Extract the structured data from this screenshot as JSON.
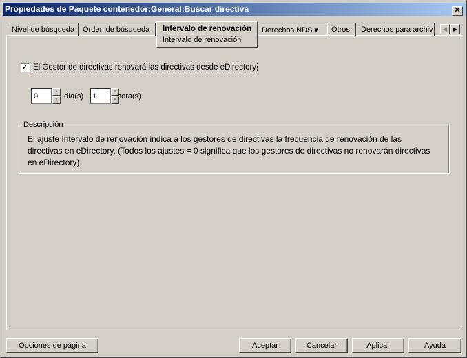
{
  "window": {
    "title": "Propiedades de Paquete contenedor:General:Buscar directiva",
    "close": "✕"
  },
  "tabs": [
    {
      "label": "Nivel de búsqueda"
    },
    {
      "label": "Orden de búsqueda"
    },
    {
      "label": "Intervalo de renovación",
      "sub": "Intervalo de renovación",
      "active": true
    },
    {
      "label": "Derechos NDS ▾"
    },
    {
      "label": "Otros"
    },
    {
      "label": "Derechos para archiv"
    }
  ],
  "scroll": {
    "left": "◀",
    "right": "▶"
  },
  "checkbox": {
    "label": "El Gestor de directivas renovará las directivas desde eDirectory",
    "checked": true,
    "mark": "✓"
  },
  "days": {
    "value": "0",
    "label": "día(s)"
  },
  "hours": {
    "value": "1",
    "label": "hora(s)"
  },
  "spin": {
    "up": "▲",
    "down": "▼"
  },
  "description": {
    "legend": "Descripción",
    "text": "El ajuste Intervalo de renovación indica a los gestores de directivas la frecuencia de renovación de las directivas en eDirectory. (Todos los ajustes = 0 significa que los gestores de directivas no renovarán directivas en eDirectory)"
  },
  "buttons": {
    "page_options": "Opciones de página",
    "accept": "Aceptar",
    "cancel": "Cancelar",
    "apply": "Aplicar",
    "help": "Ayuda"
  }
}
